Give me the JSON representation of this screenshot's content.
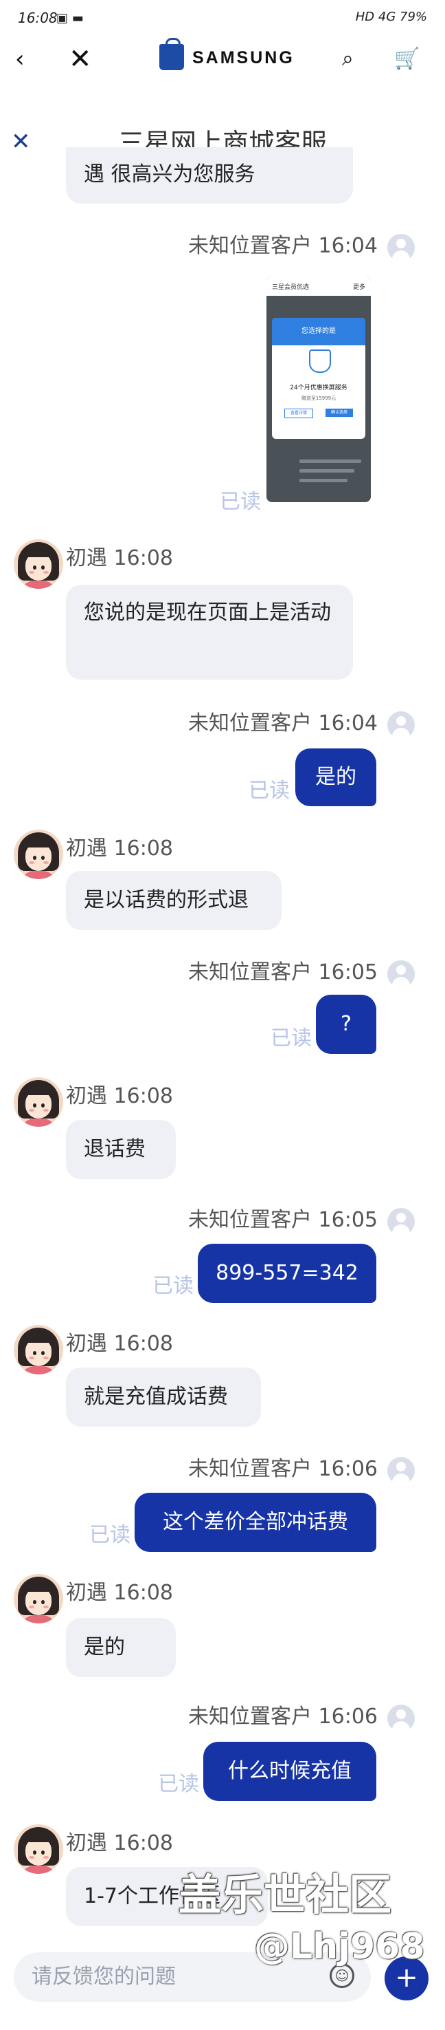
{
  "status_bar": {
    "time": "16:08",
    "right": "HD 4G 79%"
  },
  "nav": {
    "back_icon": "chevron-left-icon",
    "close_icon": "close-icon",
    "brand": "SAMSUNG",
    "search_icon": "search-icon",
    "cart_icon": "cart-icon"
  },
  "chat": {
    "close_icon": "close-icon",
    "title": "三星网上商城客服",
    "agent_name": "初遇",
    "user_name": "未知位置客户",
    "read_label": "已读",
    "first_partial": "遇 很高兴为您服务",
    "shot_meta": "未知位置客户 16:04",
    "screenshot": {
      "bar_left": "三星会员优选",
      "bar_right": "更多",
      "card_head": "您选择的是",
      "card_title": "24个月优惠换屏服务",
      "card_sub": "赠送至15999元",
      "btn_left": "查看详情",
      "btn_right": "确认选择"
    },
    "messages": [
      {
        "meta": "初遇 16:08",
        "text": "您说的是现在页面上是活动"
      },
      {
        "meta": "未知位置客户 16:04",
        "text": "是的"
      },
      {
        "meta": "初遇 16:08",
        "text": "是以话费的形式退"
      },
      {
        "meta": "未知位置客户 16:05",
        "text": "?"
      },
      {
        "meta": "初遇 16:08",
        "text": "退话费"
      },
      {
        "meta": "未知位置客户 16:05",
        "text": "899-557=342"
      },
      {
        "meta": "初遇 16:08",
        "text": "就是充值成话费"
      },
      {
        "meta": "未知位置客户 16:06",
        "text": "这个差价全部冲话费"
      },
      {
        "meta": "初遇 16:08",
        "text": "是的"
      },
      {
        "meta": "未知位置客户 16:06",
        "text": "什么时候充值"
      },
      {
        "meta": "初遇 16:08",
        "text": "1-7个工作日返"
      }
    ]
  },
  "input": {
    "placeholder": "请反馈您的问题",
    "emoji_icon": "emoji-icon",
    "plus_icon": "plus-icon"
  },
  "watermark": {
    "line1": "盖乐世社区",
    "line2": "@Lhj968"
  }
}
